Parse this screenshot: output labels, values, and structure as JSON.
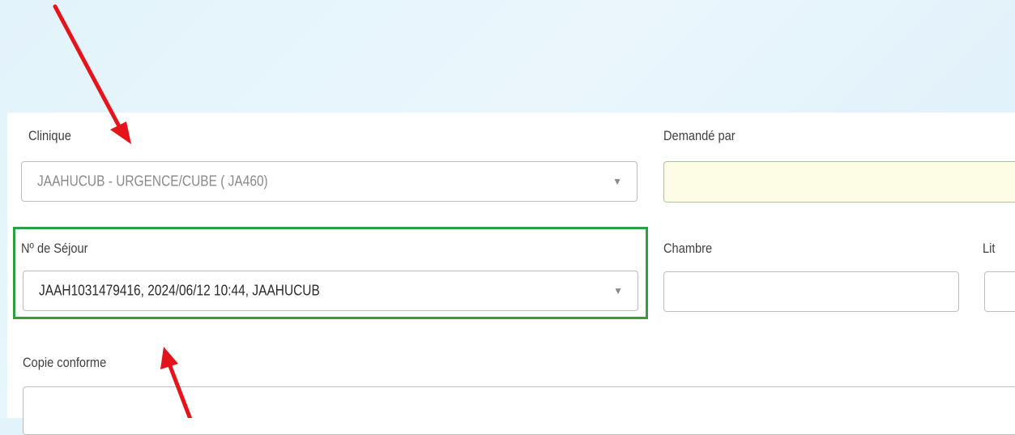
{
  "form": {
    "clinique": {
      "label": "Clinique",
      "value": "JAAHUCUB - URGENCE/CUBE ( JA460)"
    },
    "demande_par": {
      "label": "Demandé par",
      "value": ""
    },
    "sejour": {
      "label": "Nº de Séjour",
      "value": "JAAH1031479416, 2024/06/12 10:44, JAAHUCUB"
    },
    "chambre": {
      "label": "Chambre",
      "value": ""
    },
    "lit": {
      "label": "Lit",
      "value": ""
    },
    "copie_conforme": {
      "label": "Copie conforme",
      "value": ""
    }
  },
  "icons": {
    "dropdown": "▼"
  },
  "colors": {
    "highlight": "#2ea043",
    "arrow": "#e5141a",
    "required_field_bg": "#fdfde6"
  }
}
